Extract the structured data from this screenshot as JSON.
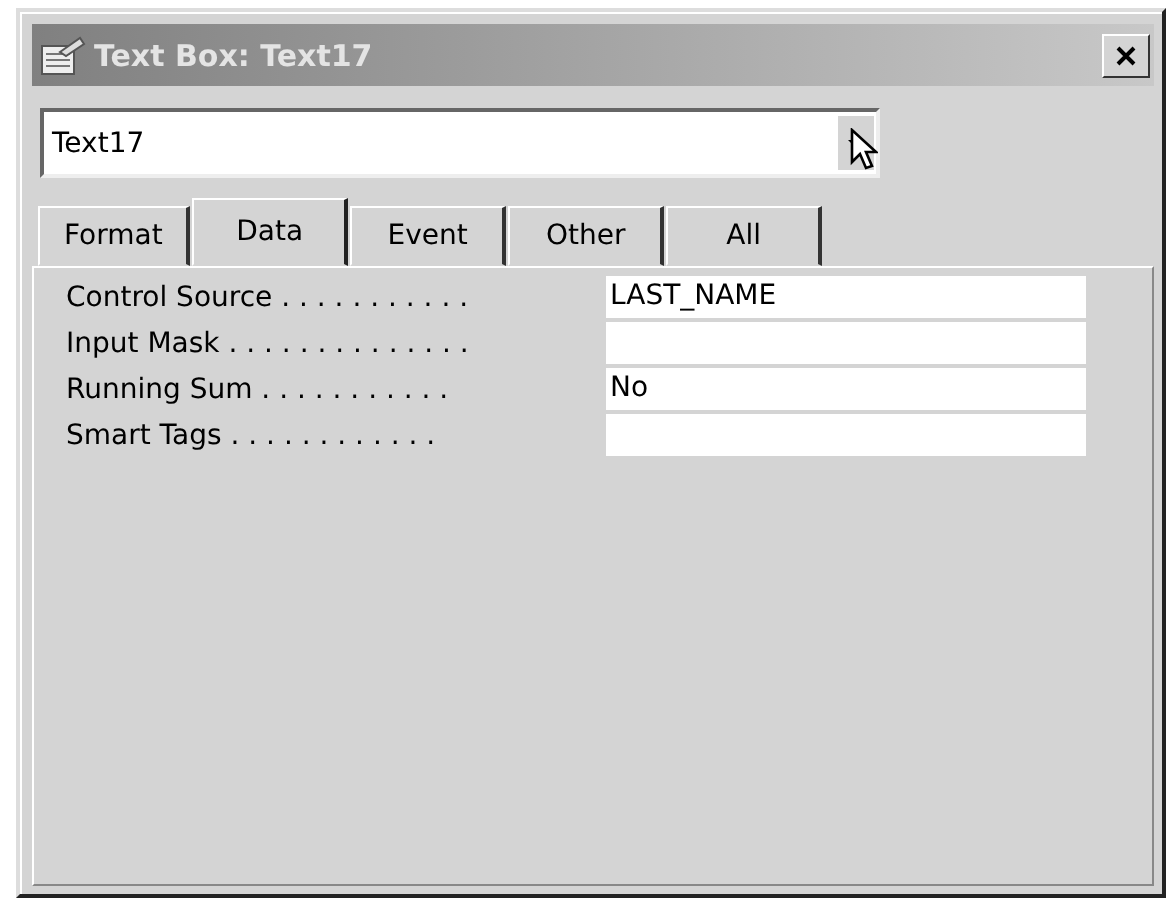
{
  "window": {
    "title": "Text Box: Text17"
  },
  "object_selector": {
    "value": "Text17"
  },
  "tabs": [
    {
      "label": "Format",
      "selected": false
    },
    {
      "label": "Data",
      "selected": true
    },
    {
      "label": "Event",
      "selected": false
    },
    {
      "label": "Other",
      "selected": false
    },
    {
      "label": "All",
      "selected": false
    }
  ],
  "properties": [
    {
      "label": "Control Source . . . . . . . . . . .",
      "value": "LAST_NAME"
    },
    {
      "label": "Input Mask . . . . . . . . . . . . . ."
    },
    {
      "label": "Running Sum . . . . . . . . . . .",
      "value": "No"
    },
    {
      "label": "Smart Tags . . . . . . . . . . . ."
    }
  ]
}
